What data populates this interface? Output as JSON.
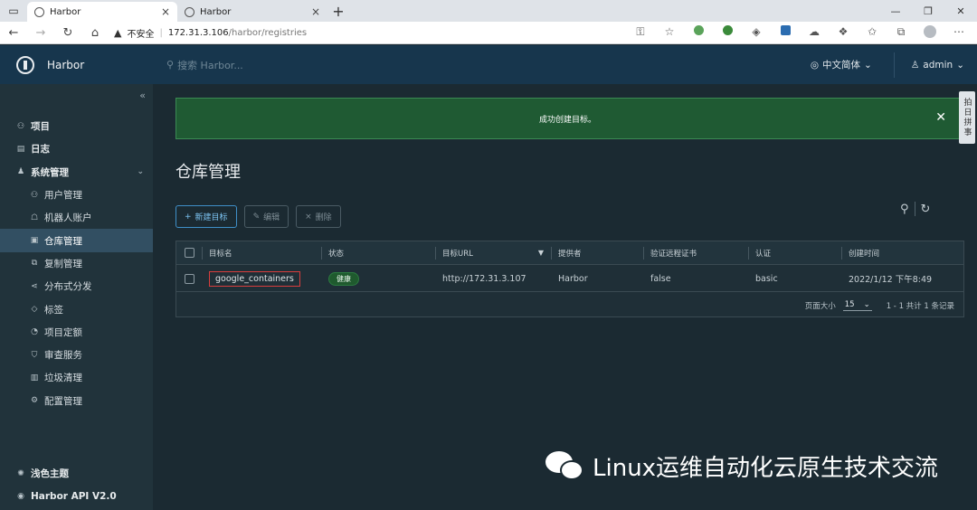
{
  "browser": {
    "tabs": [
      {
        "title": "Harbor",
        "active": true
      },
      {
        "title": "Harbor",
        "active": false
      }
    ],
    "security_label": "不安全",
    "url_host": "172.31.3.106",
    "url_path": "/harbor/registries"
  },
  "header": {
    "brand": "Harbor",
    "search_placeholder": "搜索 Harbor...",
    "language": "中文简体",
    "user": "admin"
  },
  "sidebar": {
    "items": [
      {
        "label": "项目",
        "icon": "projects-icon",
        "level": 0
      },
      {
        "label": "日志",
        "icon": "logs-icon",
        "level": 0
      },
      {
        "label": "系统管理",
        "icon": "admin-icon",
        "level": 0,
        "expanded": true
      },
      {
        "label": "用户管理",
        "icon": "users-icon",
        "level": 1
      },
      {
        "label": "机器人账户",
        "icon": "robot-icon",
        "level": 1
      },
      {
        "label": "仓库管理",
        "icon": "registry-icon",
        "level": 1,
        "active": true
      },
      {
        "label": "复制管理",
        "icon": "replication-icon",
        "level": 1
      },
      {
        "label": "分布式分发",
        "icon": "distribution-icon",
        "level": 1
      },
      {
        "label": "标签",
        "icon": "tag-icon",
        "level": 1
      },
      {
        "label": "项目定额",
        "icon": "quota-icon",
        "level": 1
      },
      {
        "label": "审查服务",
        "icon": "shield-icon",
        "level": 1
      },
      {
        "label": "垃圾清理",
        "icon": "trash-icon",
        "level": 1
      },
      {
        "label": "配置管理",
        "icon": "gear-icon",
        "level": 1
      }
    ],
    "theme_label": "浅色主题",
    "api_label": "Harbor API V2.0"
  },
  "alert": {
    "message": "成功创建目标。",
    "side_tab": "拍日拼事"
  },
  "page": {
    "title": "仓库管理"
  },
  "toolbar": {
    "new_label": "新建目标",
    "edit_label": "编辑",
    "delete_label": "删除"
  },
  "table": {
    "columns": [
      "目标名",
      "状态",
      "目标URL",
      "提供者",
      "验证远程证书",
      "认证",
      "创建时间"
    ],
    "rows": [
      {
        "name": "google_containers",
        "status": "健康",
        "url": "http://172.31.3.107",
        "provider": "Harbor",
        "verify": "false",
        "auth": "basic",
        "created": "2022/1/12 下午8:49"
      }
    ],
    "footer": {
      "page_size_label": "页面大小",
      "page_size": "15",
      "summary": "1 - 1 共计 1 条记录"
    }
  },
  "watermark": {
    "text": "Linux运维自动化云原生技术交流"
  },
  "colors": {
    "header_bg": "#17364d",
    "sidebar_bg": "#21333b",
    "main_bg": "#1b2a32",
    "alert_bg": "#1f5a33",
    "accent": "#3f8fc8",
    "highlight_border": "#d83d3d"
  }
}
